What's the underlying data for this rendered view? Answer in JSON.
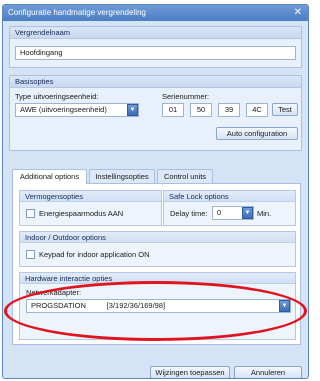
{
  "window": {
    "title": "Configuratie handmatige vergrendeling",
    "close_symbol": "✕"
  },
  "name_group": {
    "header": "Vergrendelnaam",
    "value": "Hoofdingang"
  },
  "basic_group": {
    "header": "Basisopties",
    "type_label": "Type uitvoeringseenheid:",
    "type_value": "AWE (uitvoeringseenheid)",
    "serial_label": "Serienummer:",
    "serial_parts": [
      "01",
      "50",
      "39",
      "4C"
    ],
    "test_button": "Test",
    "auto_config_button": "Auto configuration"
  },
  "tabs": [
    "Additional options",
    "Instellingsopties",
    "Control units"
  ],
  "active_tab": 0,
  "energy": {
    "header": "Vermogensopties",
    "checkbox_label": "Energiespaarmodus AAN",
    "checked": false
  },
  "safe_lock": {
    "header": "Safe Lock options",
    "delay_label": "Delay time:",
    "delay_value": "0",
    "unit": "Min."
  },
  "indoor": {
    "header": "Indoor / Outdoor options",
    "checkbox_label": "Keypad for indoor application ON",
    "checked": false
  },
  "hardware": {
    "header": "Hardware interactie opties",
    "adapter_label": "Netwerkadapter:",
    "adapter_value": "PROGSDATION          [3/192/36/169/98]"
  },
  "footer": {
    "apply_button": "Wijzingen toepassen",
    "cancel_button": "Annuleren"
  },
  "colors": {
    "accent": "#4d7dc3",
    "highlight": "#e0141e",
    "panel": "#d4e3f6"
  }
}
